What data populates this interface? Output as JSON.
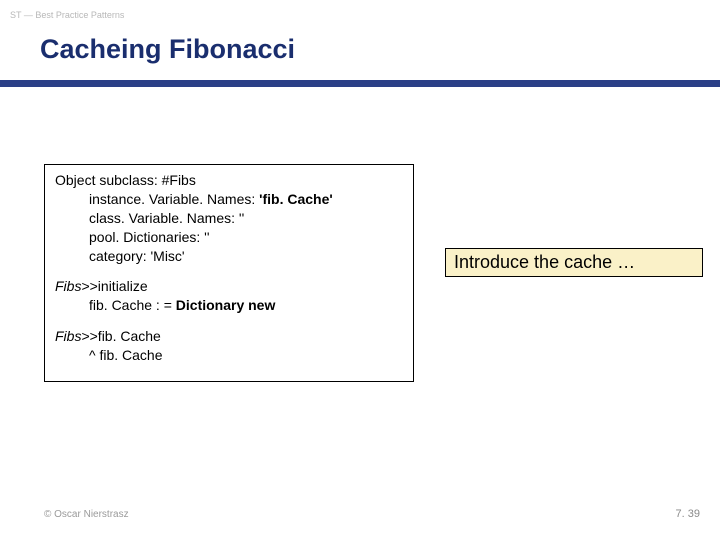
{
  "kicker": "ST — Best Practice Patterns",
  "title": "Cacheing Fibonacci",
  "code": {
    "b1l1": "Object subclass: #Fibs",
    "b1l2a": "instance. Variable. Names: ",
    "b1l2b": "'fib. Cache'",
    "b1l3a": "class. Variable. Names: ",
    "b1l3b": "''",
    "b1l4a": "pool. Dictionaries: ",
    "b1l4b": "''",
    "b1l5a": "category: ",
    "b1l5b": "'Misc'",
    "b2l1a": "Fibs",
    "b2l1b": ">>initialize",
    "b2l2a": "fib. Cache : = ",
    "b2l2b": "Dictionary new",
    "b3l1a": "Fibs",
    "b3l1b": ">>fib. Cache",
    "b3l2": "^ fib. Cache"
  },
  "callout": "Introduce the cache …",
  "footer": {
    "left": "© Oscar Nierstrasz",
    "right": "7. 39"
  }
}
